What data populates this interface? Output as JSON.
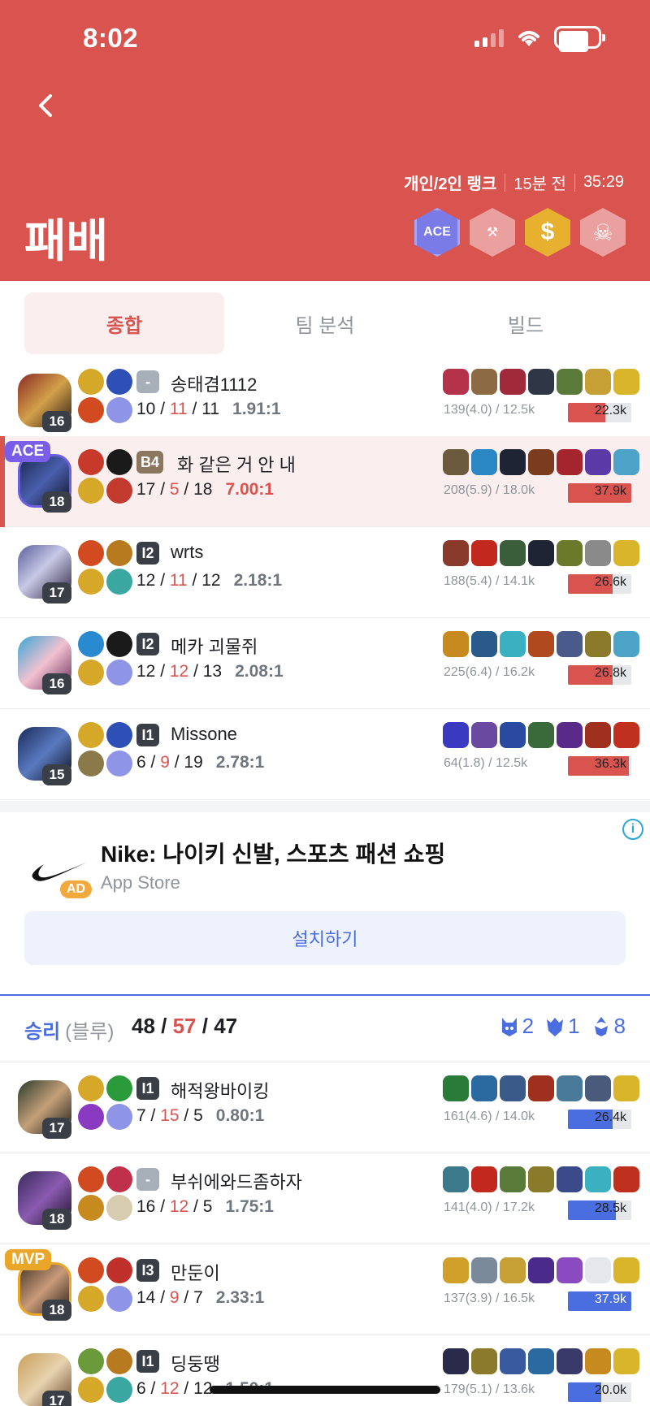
{
  "status_bar": {
    "time": "8:02"
  },
  "header": {
    "queue": "개인/2인 랭크",
    "ago": "15분 전",
    "duration": "35:29",
    "result": "패배",
    "badges": [
      {
        "name": "ace",
        "label": "ACE"
      },
      {
        "name": "tool",
        "label": "⚒"
      },
      {
        "name": "gold",
        "label": "$"
      },
      {
        "name": "skull",
        "label": "☠"
      }
    ]
  },
  "tabs": [
    "종합",
    "팀 분석",
    "빌드"
  ],
  "colors": {
    "red": "#d9534f",
    "blue": "#4a6ee0"
  },
  "red_team": [
    {
      "name": "송태겸1112",
      "level": "16",
      "tier": "-",
      "k": "10",
      "d": "11",
      "a": "11",
      "ratio": "1.91:1",
      "cs": "139(4.0) / 12.5k",
      "damage": "22.3k",
      "damage_fraction": 0.59
    },
    {
      "name": "화 같은 거 안 내",
      "level": "18",
      "tier": "B4",
      "k": "17",
      "d": "5",
      "a": "18",
      "ratio": "7.00:1",
      "cs": "208(5.9) / 18.0k",
      "damage": "37.9k",
      "damage_fraction": 1.0,
      "tag": "ACE"
    },
    {
      "name": "wrts",
      "level": "17",
      "tier": "I2",
      "k": "12",
      "d": "11",
      "a": "12",
      "ratio": "2.18:1",
      "cs": "188(5.4) / 14.1k",
      "damage": "26.6k",
      "damage_fraction": 0.7
    },
    {
      "name": "메카 괴물쥐",
      "level": "16",
      "tier": "I2",
      "k": "12",
      "d": "12",
      "a": "13",
      "ratio": "2.08:1",
      "cs": "225(6.4) / 16.2k",
      "damage": "26.8k",
      "damage_fraction": 0.71
    },
    {
      "name": "Missone",
      "level": "15",
      "tier": "I1",
      "k": "6",
      "d": "9",
      "a": "19",
      "ratio": "2.78:1",
      "cs": "64(1.8) / 12.5k",
      "damage": "36.3k",
      "damage_fraction": 0.96
    }
  ],
  "ad": {
    "title": "Nike: 나이키 신발, 스포츠 패션 쇼핑",
    "source": "App Store",
    "tag": "AD",
    "install": "설치하기",
    "info": "i"
  },
  "blue_summary": {
    "result": "승리",
    "side": "(블루)",
    "k": "48",
    "d": "57",
    "a": "47",
    "towers": "2",
    "barons": "1",
    "dragons": "8"
  },
  "blue_team": [
    {
      "name": "해적왕바이킹",
      "level": "17",
      "tier": "I1",
      "k": "7",
      "d": "15",
      "a": "5",
      "ratio": "0.80:1",
      "cs": "161(4.6) / 14.0k",
      "damage": "26.4k",
      "damage_fraction": 0.7
    },
    {
      "name": "부쉬에와드좀하자",
      "level": "18",
      "tier": "-",
      "k": "16",
      "d": "12",
      "a": "5",
      "ratio": "1.75:1",
      "cs": "141(4.0) / 17.2k",
      "damage": "28.5k",
      "damage_fraction": 0.75
    },
    {
      "name": "만둔이",
      "level": "18",
      "tier": "I3",
      "k": "14",
      "d": "9",
      "a": "7",
      "ratio": "2.33:1",
      "cs": "137(3.9) / 16.5k",
      "damage": "37.9k",
      "damage_fraction": 1.0,
      "tag": "MVP"
    },
    {
      "name": "딩둥땡",
      "level": "17",
      "tier": "I1",
      "k": "6",
      "d": "12",
      "a": "12",
      "ratio": "1.50:1",
      "cs": "179(5.1) / 13.6k",
      "damage": "20.0k",
      "damage_fraction": 0.53
    }
  ]
}
